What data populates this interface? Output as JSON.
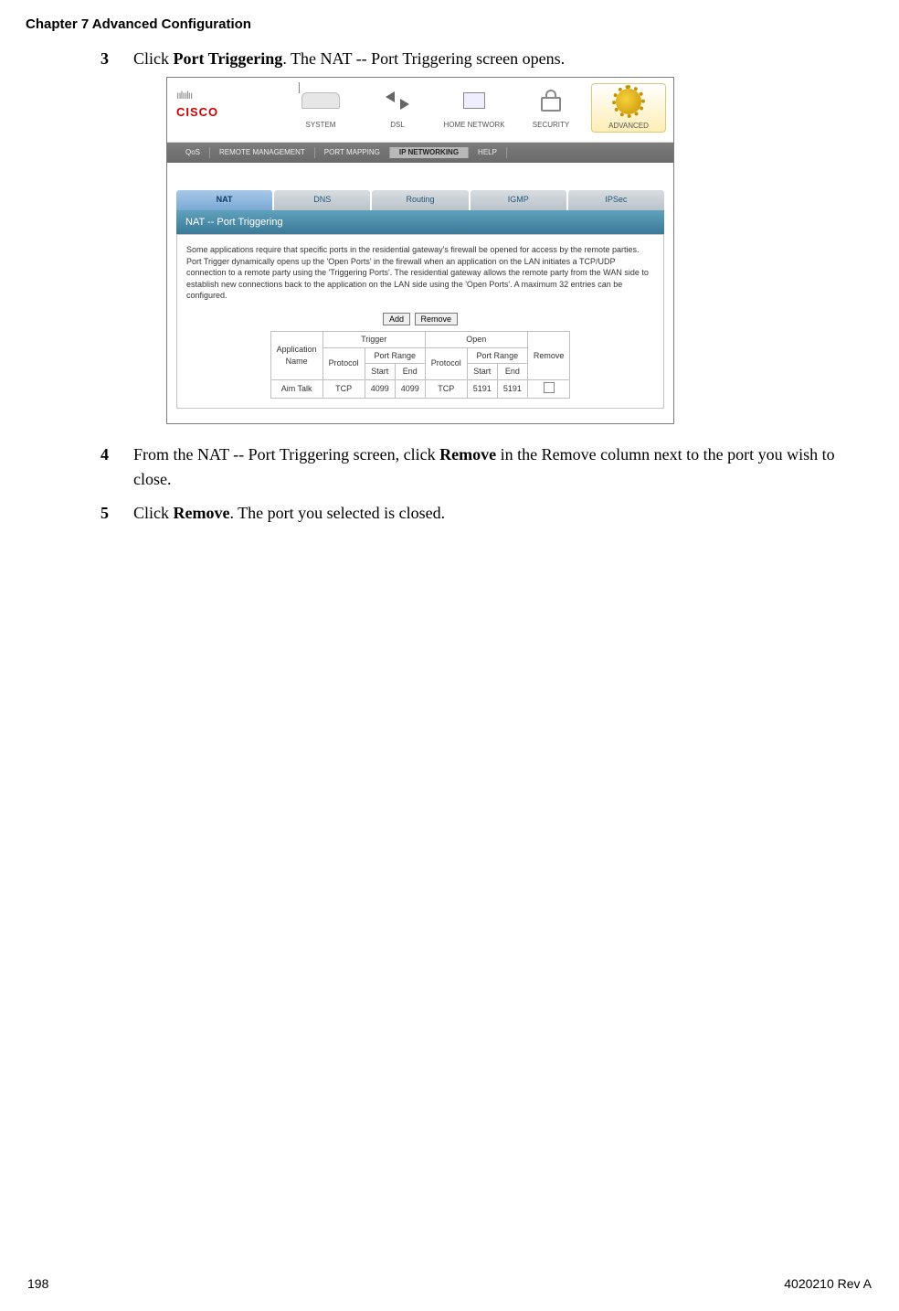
{
  "header": {
    "chapter": "Chapter 7    Advanced Configuration"
  },
  "steps": {
    "s3": {
      "num": "3",
      "prefix": "Click ",
      "bold": "Port Triggering",
      "suffix": ". The NAT -- Port Triggering screen opens."
    },
    "s4": {
      "num": "4",
      "prefix": "From the NAT -- Port Triggering screen, click ",
      "bold": "Remove",
      "suffix": " in the Remove column next to the port you wish to close."
    },
    "s5": {
      "num": "5",
      "prefix": "Click ",
      "bold": "Remove",
      "suffix": ". The port you selected is closed."
    }
  },
  "ui": {
    "logo_bars": "ıılıılıı",
    "logo_name": "CISCO",
    "topcats": {
      "system": "SYSTEM",
      "dsl": "DSL",
      "home": "HOME NETWORK",
      "security": "SECURITY",
      "advanced": "ADVANCED"
    },
    "subnav": {
      "qos": "QoS",
      "remote": "REMOTE MANAGEMENT",
      "portmap": "PORT MAPPING",
      "ipnet": "IP NETWORKING",
      "help": "HELP"
    },
    "subtabs": {
      "nat": "NAT",
      "dns": "DNS",
      "routing": "Routing",
      "igmp": "IGMP",
      "ipsec": "IPSec"
    },
    "panel_title": "NAT -- Port Triggering",
    "panel_desc": "Some applications require that specific ports in the residential gateway's firewall be opened for access by the remote parties. Port Trigger dynamically opens up the 'Open Ports' in the firewall when an application on the LAN initiates a TCP/UDP connection to a remote party using the 'Triggering Ports'. The residential gateway allows the remote party from the WAN side to establish new connections back to the application on the LAN side using the 'Open Ports'. A maximum 32 entries can be configured.",
    "buttons": {
      "add": "Add",
      "remove": "Remove"
    },
    "table": {
      "h_app": "Application",
      "h_trigger": "Trigger",
      "h_open": "Open",
      "h_remove": "Remove",
      "h_name": "Name",
      "h_protocol": "Protocol",
      "h_portrange": "Port Range",
      "h_start": "Start",
      "h_end": "End",
      "row": {
        "name": "Aim Talk",
        "t_proto": "TCP",
        "t_start": "4099",
        "t_end": "4099",
        "o_proto": "TCP",
        "o_start": "5191",
        "o_end": "5191"
      }
    }
  },
  "footer": {
    "page": "198",
    "doc": "4020210 Rev A"
  }
}
